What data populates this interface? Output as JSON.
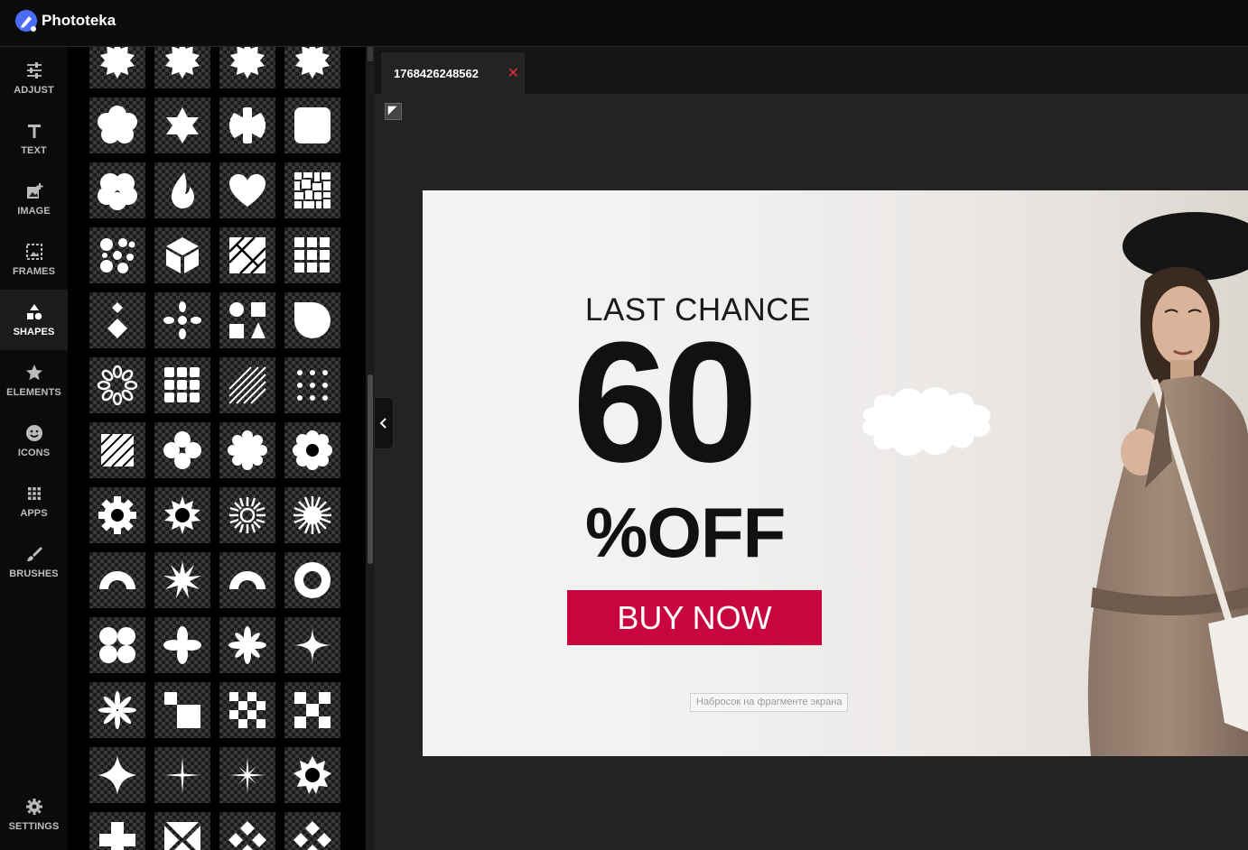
{
  "app": {
    "name": "Phototeka"
  },
  "sidebar": {
    "items": [
      {
        "label": "ADJUST",
        "icon": "sliders-icon"
      },
      {
        "label": "TEXT",
        "icon": "text-icon"
      },
      {
        "label": "IMAGE",
        "icon": "image-add-icon"
      },
      {
        "label": "FRAMES",
        "icon": "frame-icon"
      },
      {
        "label": "SHAPES",
        "icon": "shapes-icon",
        "active": true
      },
      {
        "label": "ELEMENTS",
        "icon": "star-icon"
      },
      {
        "label": "ICONS",
        "icon": "smiley-icon"
      },
      {
        "label": "APPS",
        "icon": "apps-grid-icon"
      },
      {
        "label": "BRUSHES",
        "icon": "brush-icon"
      }
    ],
    "settings": {
      "label": "SETTINGS",
      "icon": "gear-icon"
    }
  },
  "tab": {
    "title": "1768426248562",
    "close": "✕"
  },
  "canvas": {
    "headline": "LAST CHANCE",
    "discount": "60",
    "off_text": "%OFF",
    "cta": "BUY NOW",
    "cta_color": "#c8053f",
    "overlay_note": "Набросок на фрагменте экрана"
  },
  "shapes": [
    "starburst-shape",
    "starburst-shape",
    "starburst-shape",
    "starburst-shape",
    "flower-shape",
    "six-point-star-shape",
    "asterisk-shape",
    "rounded-square-shape",
    "cloud-shape",
    "flame-shape",
    "heart-shape",
    "mosaic-shape",
    "dots-cluster-shape",
    "cube-shape",
    "diagonal-squares-shape",
    "grid-squares-shape",
    "diamond-stack-shape",
    "molecule-shape",
    "geometric-set-shape",
    "d-shape",
    "petal-ring-shape",
    "block-grid-shape",
    "stripes-shape",
    "dot-grid-shape",
    "striped-square-shape",
    "four-petal-shape",
    "cog-flower-shape",
    "scalloped-ring-shape",
    "gear-shape",
    "sun-shape",
    "sunburst-shape",
    "radial-burst-shape",
    "arch-shape",
    "spiky-star-shape",
    "arch-shape",
    "ring-shape",
    "four-circles-shape",
    "cross-petal-shape",
    "star-flower-shape",
    "sparkle-shape",
    "asterisk-flower-shape",
    "steps-shape",
    "checker-shape",
    "checker-x-shape",
    "four-point-star-shape",
    "thin-sparkle-shape",
    "thin-star-shape",
    "badge-shape",
    "plus-shape",
    "hourglass-x-shape",
    "diamond-quad-shape",
    "diamond-quad-shape"
  ]
}
